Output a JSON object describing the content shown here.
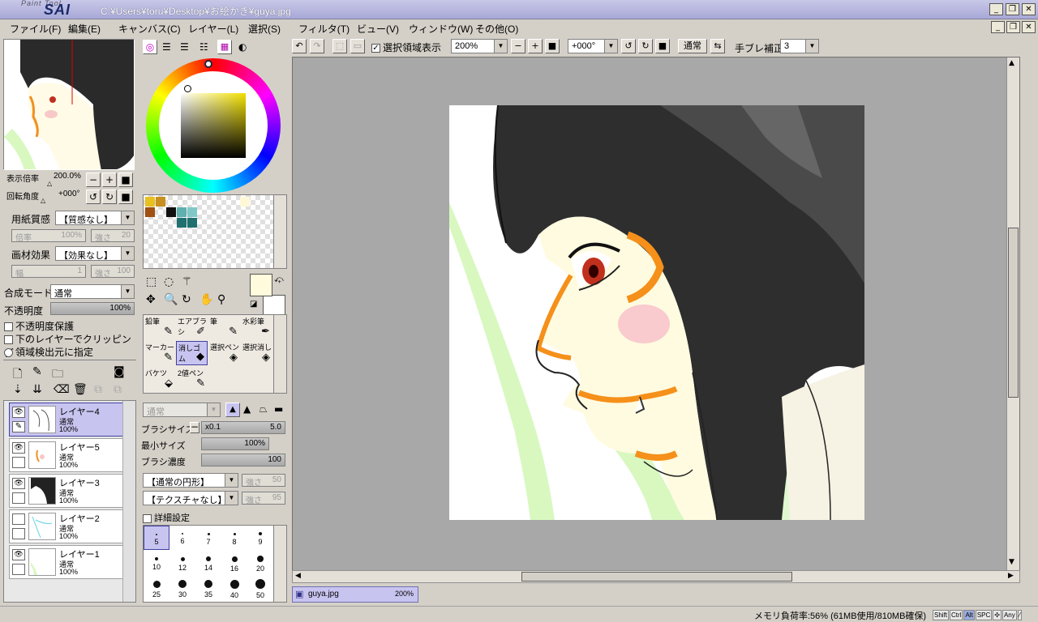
{
  "window": {
    "logo_small": "Paint Tool",
    "logo": "SAI",
    "path": "C:¥Users¥toru¥Desktop¥お絵かき¥guya.jpg"
  },
  "menu": [
    "ファイル(F)",
    "編集(E)",
    "キャンバス(C)",
    "レイヤー(L)",
    "選択(S)",
    "フィルタ(T)",
    "ビュー(V)",
    "ウィンドウ(W)",
    "その他(O)"
  ],
  "navigator": {
    "zoom_label": "表示倍率",
    "zoom_value": "200.0%",
    "rot_label": "回転角度",
    "rot_value": "+000°"
  },
  "paper": {
    "texture_label": "用紙質感",
    "texture_value": "【質感なし】",
    "tex_scale_label": "倍率",
    "tex_scale_value": "100%",
    "tex_strength_label": "強さ",
    "tex_strength_value": "20",
    "effect_label": "画材効果",
    "effect_value": "【効果なし】",
    "eff_width_label": "幅",
    "eff_width_value": "1",
    "eff_strength_label": "強さ",
    "eff_strength_value": "100"
  },
  "layer_props": {
    "blend_label": "合成モード",
    "blend_value": "通常",
    "opacity_label": "不透明度",
    "opacity_value": "100%",
    "opacity_fraction": 1.0,
    "protect_label": "不透明度保護",
    "clip_label": "下のレイヤーでクリッピング",
    "detect_label": "領域検出元に指定"
  },
  "layers": [
    {
      "name": "レイヤー4",
      "mode": "通常",
      "opacity": "100%",
      "visible": true,
      "selected": true
    },
    {
      "name": "レイヤー5",
      "mode": "通常",
      "opacity": "100%",
      "visible": true,
      "selected": false
    },
    {
      "name": "レイヤー3",
      "mode": "通常",
      "opacity": "100%",
      "visible": true,
      "selected": false
    },
    {
      "name": "レイヤー2",
      "mode": "通常",
      "opacity": "100%",
      "visible": false,
      "selected": false
    },
    {
      "name": "レイヤー1",
      "mode": "通常",
      "opacity": "100%",
      "visible": true,
      "selected": false
    }
  ],
  "tools": [
    {
      "name": "鉛筆",
      "icon": "✎"
    },
    {
      "name": "エアブラシ",
      "icon": "✐"
    },
    {
      "name": "筆",
      "icon": "✎"
    },
    {
      "name": "水彩筆",
      "icon": "✒"
    },
    {
      "name": "マーカー",
      "icon": "✎"
    },
    {
      "name": "消しゴム",
      "icon": "◆"
    },
    {
      "name": "選択ペン",
      "icon": "◈"
    },
    {
      "name": "選択消し",
      "icon": "◈"
    },
    {
      "name": "バケツ",
      "icon": "⬙"
    },
    {
      "name": "2値ペン",
      "icon": "✎"
    }
  ],
  "brush": {
    "mode_value": "通常",
    "size_label": "ブラシサイズ",
    "size_mult": "x0.1",
    "size_value": "5.0",
    "min_size_label": "最小サイズ",
    "min_size_value": "100%",
    "density_label": "ブラシ濃度",
    "density_value": "100",
    "shape_value": "【通常の円形】",
    "shape_strength_label": "強さ",
    "shape_strength_value": "50",
    "texture_value": "【テクスチャなし】",
    "tex_strength_label": "強さ",
    "tex_strength_value": "95",
    "detail_label": "詳細設定",
    "sizes": [
      "5",
      "6",
      "7",
      "8",
      "9",
      "10",
      "12",
      "14",
      "16",
      "20",
      "25",
      "30",
      "35",
      "40",
      "50"
    ]
  },
  "toolbar": {
    "show_selection_label": "選択領域表示",
    "zoom_value": "200%",
    "angle_value": "+000°",
    "blend_value": "通常",
    "stabilizer_label": "手ブレ補正",
    "stabilizer_value": "3"
  },
  "tab": {
    "filename": "guya.jpg",
    "zoom": "200%"
  },
  "status": {
    "memory": "メモリ負荷率:56% (61MB使用/810MB確保)",
    "keys": [
      "Shift",
      "Ctrl",
      "Alt",
      "SPC",
      "✣",
      "Any",
      "⁄"
    ]
  },
  "colors": {
    "accent": "#c8c4f0",
    "palette": [
      "#e8c020",
      "#c89020",
      "#ffffff",
      "#a05010",
      "#101010",
      "#60b0b0",
      "#80c8c8",
      "#207070",
      "#207070",
      "#fff8d8"
    ],
    "main_color": "#fffbdc"
  }
}
